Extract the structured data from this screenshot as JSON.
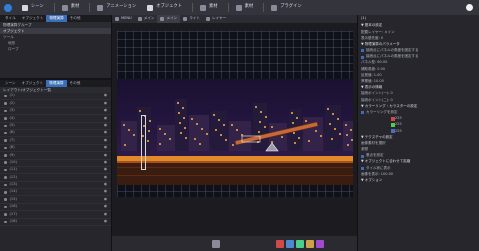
{
  "menubar": {
    "tabs": [
      {
        "label": "シーン"
      },
      {
        "label": "素材"
      },
      {
        "label": "アニメーション"
      },
      {
        "label": "オブジェクト"
      },
      {
        "label": "素材"
      },
      {
        "label": "素材"
      },
      {
        "label": "プラグイン"
      }
    ]
  },
  "left": {
    "top_tabs": [
      "タイル",
      "オブジェクト",
      "物理演算",
      "その他"
    ],
    "tree_header": "物理演算グループ",
    "tree_items": [
      "オブジェクト",
      "ツール",
      "地形",
      "ロープ"
    ],
    "bottom_tabs": [
      "シーン",
      "オブジェクト",
      "物理演算",
      "その他"
    ],
    "layer_header": "レイアウト/オブジェクト一覧",
    "layers": [
      "(1)",
      "(2)",
      "(3)",
      "(4)",
      "(5)",
      "(6)",
      "(7)",
      "(8)",
      "(9)",
      "(10)",
      "(11)",
      "(12)",
      "(13)",
      "(14)",
      "(15)",
      "(16)",
      "(17)",
      "(18)"
    ]
  },
  "center": {
    "tabs": [
      "MENU",
      "メイン",
      "メイン",
      "ライト",
      "レイヤー"
    ]
  },
  "right": {
    "title": "(1)",
    "rows": [
      "▼ 基本の設定",
      "配置レイヤー: メイン",
      "表示優先度: 0",
      "▼ 物理演算のパラメータ",
      "接続点にパネルの角度を固定する",
      "接続点にパネルの角度を固定する",
      "パネル型: 60.00",
      "補助角度: 0.00",
      "反発値: 1.00",
      "摩擦値: 10.00",
      "▼ 表示の情報",
      "接続ポイント(一): 0",
      "接続ポイント(二): 0",
      "▼ カラーリング・カラスターの設定",
      "カラーリングを設定",
      "255",
      "255",
      "255",
      "▼ テクスチャの設定",
      "画像素材を選択",
      "参照",
      "基点を設定",
      "▼ オブジェクトに合わせて拡縮",
      "タイル状に表示",
      "画像を表示: 100.00",
      "▼ オプション"
    ],
    "browse_label": "参照"
  },
  "colors": {
    "accent": "#3a6fb8",
    "seesaw": "#c46a3a",
    "ground": "#e08a2a",
    "sky_top": "#1a1030"
  }
}
